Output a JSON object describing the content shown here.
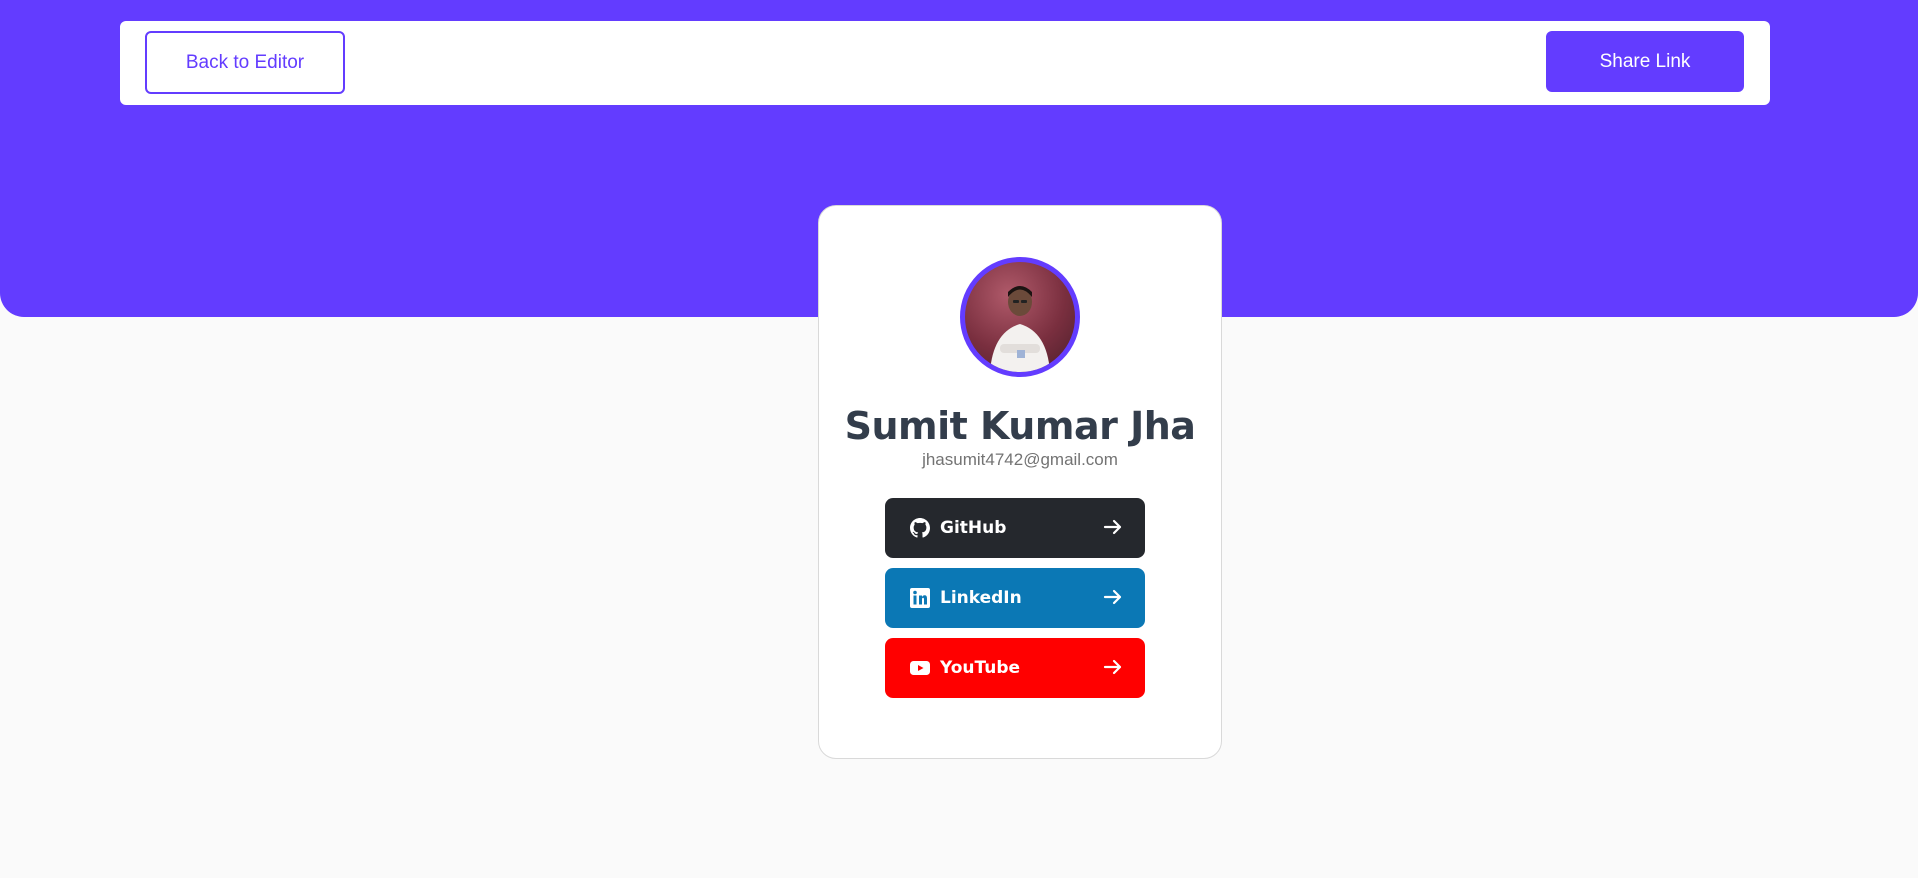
{
  "header": {
    "back_label": "Back to Editor",
    "share_label": "Share Link"
  },
  "profile": {
    "name": "Sumit Kumar Jha",
    "email": "jhasumit4742@gmail.com",
    "avatar_icon": "profile-photo"
  },
  "links": [
    {
      "label": "GitHub",
      "icon": "github-icon",
      "color": "#25282d"
    },
    {
      "label": "LinkedIn",
      "icon": "linkedin-icon",
      "color": "#0b78b5"
    },
    {
      "label": "YouTube",
      "icon": "youtube-icon",
      "color": "#ff0000"
    }
  ],
  "colors": {
    "accent": "#633cff",
    "background": "#fafafa"
  }
}
